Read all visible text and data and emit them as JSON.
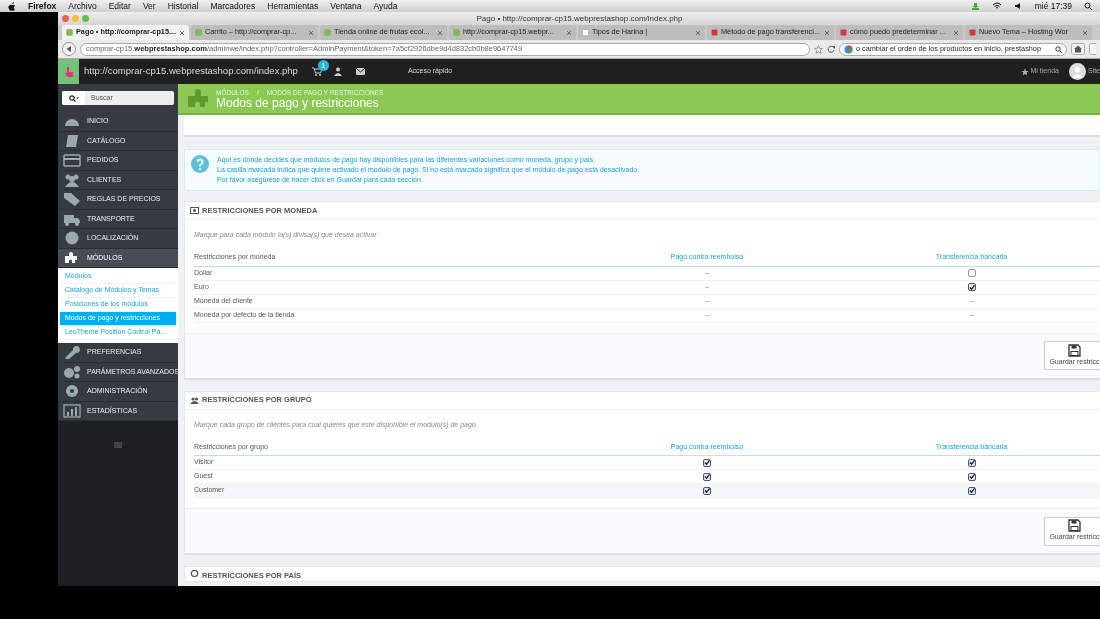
{
  "menubar": {
    "app": "Firefox",
    "items": [
      "Archivo",
      "Editar",
      "Ver",
      "Historial",
      "Marcadores",
      "Herramientas",
      "Ventana",
      "Ayuda"
    ],
    "clock": "mié 17:39"
  },
  "window": {
    "title": "Pago • http://comprar-cp15.webprestashop.com/index.php"
  },
  "tabs": [
    {
      "label": "Pago • http://comprar-cp15....",
      "selected": true
    },
    {
      "label": "Carrito – http://comprar-cp...",
      "selected": false
    },
    {
      "label": "Tienda online de frutas ecol...",
      "selected": false
    },
    {
      "label": "http://comprar-cp15.webpr...",
      "selected": false
    },
    {
      "label": "Tipos de Harina |",
      "selected": false
    },
    {
      "label": "Método de pago transferenci...",
      "selected": false
    },
    {
      "label": "cómo puedo predeterminar ...",
      "selected": false
    },
    {
      "label": "Nuevo Tema – Hosting Wor",
      "selected": false
    }
  ],
  "address_bar": {
    "url": "comprar-cp15.**webprestashop.com**/adminwe/index.php?controller=AdminPayment&token=7a5cf2926dbe9d4d832cb0b8e9647749"
  },
  "search_bar": {
    "value": "o cambiar el orden de los productos en inicio, prestashop"
  },
  "header": {
    "shop_url": "http://comprar-cp15.webprestashop.com/index.php",
    "cart_count": "1",
    "quick_access": "Acceso rápido",
    "my_shop": "Mi tienda",
    "user": "Site"
  },
  "sidebar": {
    "search_placeholder": "Buscar",
    "items": [
      {
        "label": "INICIO",
        "selected": false
      },
      {
        "label": "CATÁLOGO",
        "selected": false
      },
      {
        "label": "PEDIDOS",
        "selected": false
      },
      {
        "label": "CLIENTES",
        "selected": false
      },
      {
        "label": "REGLAS DE PRECIOS",
        "selected": false
      },
      {
        "label": "TRANSPORTE",
        "selected": false
      },
      {
        "label": "LOCALIZACIÓN",
        "selected": false
      },
      {
        "label": "MÓDULOS",
        "selected": true,
        "expanded": true,
        "children": [
          {
            "label": "Módulos",
            "selected": false
          },
          {
            "label": "Catalogo de Módulos y Temas",
            "selected": false
          },
          {
            "label": "Posiciones de los módulos",
            "selected": false
          },
          {
            "label": "Modos de pago y restricciones",
            "selected": true
          },
          {
            "label": "LeoTheme Position Control Pa...",
            "selected": false
          }
        ]
      },
      {
        "label": "PREFERENCIAS",
        "selected": false
      },
      {
        "label": "PARÁMETROS AVANZADOS",
        "selected": false
      },
      {
        "label": "ADMINISTRACIÓN",
        "selected": false
      },
      {
        "label": "ESTADÍSTICAS",
        "selected": false
      }
    ]
  },
  "page_header": {
    "breadcrumb": [
      "MÓDULOS",
      "MODOS DE PAGO Y RESTRICCIONES"
    ],
    "breadcrumb_separator": "/",
    "title": "Modos de pago y restricciones"
  },
  "info": [
    "Aquí es donde decides que módulos de pago hay disponibles para las diferentes variaciones como moneda, grupo y país.",
    "La casilla marcada indica que quiere activado el modulo de pago. Si no está marcado significa que el módulo de pago está desactivado.",
    "Por favor asegúrese de hacer click en Guardar para cada sección."
  ],
  "sections": [
    {
      "title": "RESTRICCIONES POR MONEDA",
      "help": "Marque para cada módulo la(s) divisa(s) que desea activar",
      "columns": [
        "Restricciones por moneda",
        "Pago contra reembolso",
        "Transferencia bancaria"
      ],
      "rows": [
        {
          "cells": [
            {
              "kind": "text",
              "text": "Dollar"
            },
            {
              "kind": "dash",
              "text": "--"
            },
            {
              "kind": "checkbox",
              "checked": false
            }
          ]
        },
        {
          "cells": [
            {
              "kind": "text",
              "text": "Euro"
            },
            {
              "kind": "dash",
              "text": "--"
            },
            {
              "kind": "checkbox",
              "checked": true
            }
          ]
        },
        {
          "cells": [
            {
              "kind": "text",
              "text": "Moneda del cliente"
            },
            {
              "kind": "dash",
              "text": "--"
            },
            {
              "kind": "dash",
              "text": "--"
            }
          ]
        },
        {
          "cells": [
            {
              "kind": "text",
              "text": "Moneda por defecto de la tienda"
            },
            {
              "kind": "dash",
              "text": "--"
            },
            {
              "kind": "dash",
              "text": "--"
            }
          ]
        }
      ],
      "save": "Guardar restricc"
    },
    {
      "title": "RESTRICCIONES POR GRUPO",
      "help": "Marque cada grupo de clientes para cual quieres que este disponible el modulo(s) de pago.",
      "columns": [
        "Restricciones por grupo",
        "Pago contra reembolso",
        "Transferencia bancaria"
      ],
      "rows": [
        {
          "cells": [
            {
              "kind": "text",
              "text": "Visitor"
            },
            {
              "kind": "checkbox",
              "checked": true
            },
            {
              "kind": "checkbox",
              "checked": true
            }
          ]
        },
        {
          "cells": [
            {
              "kind": "text",
              "text": "Guest"
            },
            {
              "kind": "checkbox",
              "checked": true
            },
            {
              "kind": "checkbox",
              "checked": true
            }
          ]
        },
        {
          "cells": [
            {
              "kind": "text",
              "text": "Customer"
            },
            {
              "kind": "checkbox",
              "checked": true
            },
            {
              "kind": "checkbox",
              "checked": true
            }
          ]
        }
      ],
      "save": "Guardar restricc"
    },
    {
      "title": "RESTRICCIONES POR PAÍS"
    }
  ]
}
